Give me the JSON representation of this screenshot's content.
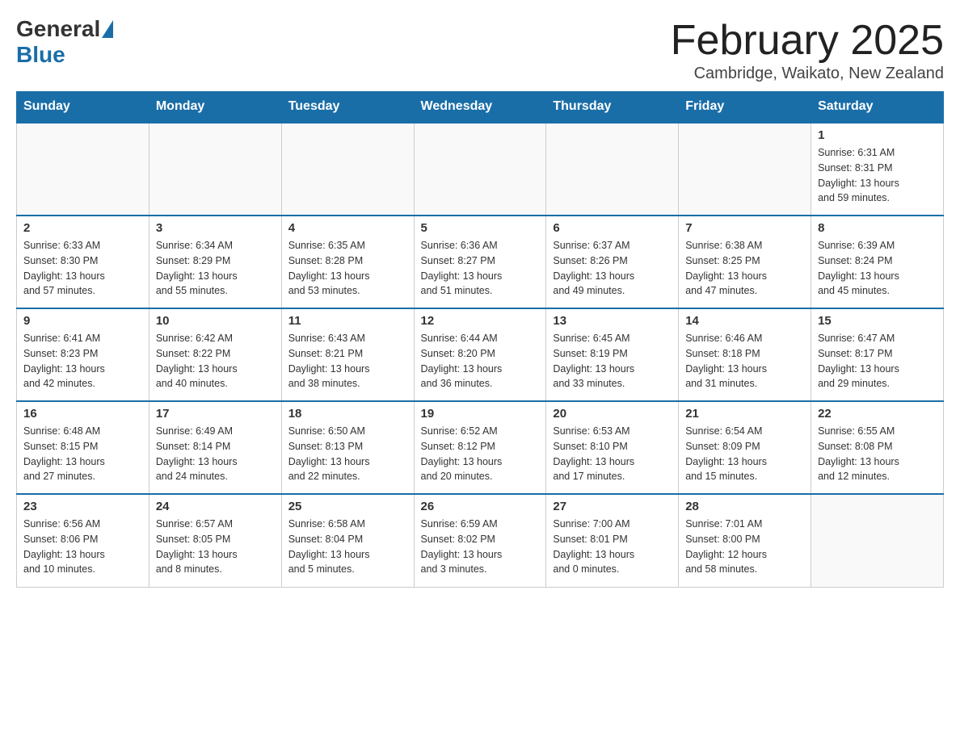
{
  "logo": {
    "general": "General",
    "blue": "Blue"
  },
  "title": "February 2025",
  "location": "Cambridge, Waikato, New Zealand",
  "days_header": [
    "Sunday",
    "Monday",
    "Tuesday",
    "Wednesday",
    "Thursday",
    "Friday",
    "Saturday"
  ],
  "weeks": [
    [
      {
        "day": "",
        "info": ""
      },
      {
        "day": "",
        "info": ""
      },
      {
        "day": "",
        "info": ""
      },
      {
        "day": "",
        "info": ""
      },
      {
        "day": "",
        "info": ""
      },
      {
        "day": "",
        "info": ""
      },
      {
        "day": "1",
        "info": "Sunrise: 6:31 AM\nSunset: 8:31 PM\nDaylight: 13 hours\nand 59 minutes."
      }
    ],
    [
      {
        "day": "2",
        "info": "Sunrise: 6:33 AM\nSunset: 8:30 PM\nDaylight: 13 hours\nand 57 minutes."
      },
      {
        "day": "3",
        "info": "Sunrise: 6:34 AM\nSunset: 8:29 PM\nDaylight: 13 hours\nand 55 minutes."
      },
      {
        "day": "4",
        "info": "Sunrise: 6:35 AM\nSunset: 8:28 PM\nDaylight: 13 hours\nand 53 minutes."
      },
      {
        "day": "5",
        "info": "Sunrise: 6:36 AM\nSunset: 8:27 PM\nDaylight: 13 hours\nand 51 minutes."
      },
      {
        "day": "6",
        "info": "Sunrise: 6:37 AM\nSunset: 8:26 PM\nDaylight: 13 hours\nand 49 minutes."
      },
      {
        "day": "7",
        "info": "Sunrise: 6:38 AM\nSunset: 8:25 PM\nDaylight: 13 hours\nand 47 minutes."
      },
      {
        "day": "8",
        "info": "Sunrise: 6:39 AM\nSunset: 8:24 PM\nDaylight: 13 hours\nand 45 minutes."
      }
    ],
    [
      {
        "day": "9",
        "info": "Sunrise: 6:41 AM\nSunset: 8:23 PM\nDaylight: 13 hours\nand 42 minutes."
      },
      {
        "day": "10",
        "info": "Sunrise: 6:42 AM\nSunset: 8:22 PM\nDaylight: 13 hours\nand 40 minutes."
      },
      {
        "day": "11",
        "info": "Sunrise: 6:43 AM\nSunset: 8:21 PM\nDaylight: 13 hours\nand 38 minutes."
      },
      {
        "day": "12",
        "info": "Sunrise: 6:44 AM\nSunset: 8:20 PM\nDaylight: 13 hours\nand 36 minutes."
      },
      {
        "day": "13",
        "info": "Sunrise: 6:45 AM\nSunset: 8:19 PM\nDaylight: 13 hours\nand 33 minutes."
      },
      {
        "day": "14",
        "info": "Sunrise: 6:46 AM\nSunset: 8:18 PM\nDaylight: 13 hours\nand 31 minutes."
      },
      {
        "day": "15",
        "info": "Sunrise: 6:47 AM\nSunset: 8:17 PM\nDaylight: 13 hours\nand 29 minutes."
      }
    ],
    [
      {
        "day": "16",
        "info": "Sunrise: 6:48 AM\nSunset: 8:15 PM\nDaylight: 13 hours\nand 27 minutes."
      },
      {
        "day": "17",
        "info": "Sunrise: 6:49 AM\nSunset: 8:14 PM\nDaylight: 13 hours\nand 24 minutes."
      },
      {
        "day": "18",
        "info": "Sunrise: 6:50 AM\nSunset: 8:13 PM\nDaylight: 13 hours\nand 22 minutes."
      },
      {
        "day": "19",
        "info": "Sunrise: 6:52 AM\nSunset: 8:12 PM\nDaylight: 13 hours\nand 20 minutes."
      },
      {
        "day": "20",
        "info": "Sunrise: 6:53 AM\nSunset: 8:10 PM\nDaylight: 13 hours\nand 17 minutes."
      },
      {
        "day": "21",
        "info": "Sunrise: 6:54 AM\nSunset: 8:09 PM\nDaylight: 13 hours\nand 15 minutes."
      },
      {
        "day": "22",
        "info": "Sunrise: 6:55 AM\nSunset: 8:08 PM\nDaylight: 13 hours\nand 12 minutes."
      }
    ],
    [
      {
        "day": "23",
        "info": "Sunrise: 6:56 AM\nSunset: 8:06 PM\nDaylight: 13 hours\nand 10 minutes."
      },
      {
        "day": "24",
        "info": "Sunrise: 6:57 AM\nSunset: 8:05 PM\nDaylight: 13 hours\nand 8 minutes."
      },
      {
        "day": "25",
        "info": "Sunrise: 6:58 AM\nSunset: 8:04 PM\nDaylight: 13 hours\nand 5 minutes."
      },
      {
        "day": "26",
        "info": "Sunrise: 6:59 AM\nSunset: 8:02 PM\nDaylight: 13 hours\nand 3 minutes."
      },
      {
        "day": "27",
        "info": "Sunrise: 7:00 AM\nSunset: 8:01 PM\nDaylight: 13 hours\nand 0 minutes."
      },
      {
        "day": "28",
        "info": "Sunrise: 7:01 AM\nSunset: 8:00 PM\nDaylight: 12 hours\nand 58 minutes."
      },
      {
        "day": "",
        "info": ""
      }
    ]
  ]
}
